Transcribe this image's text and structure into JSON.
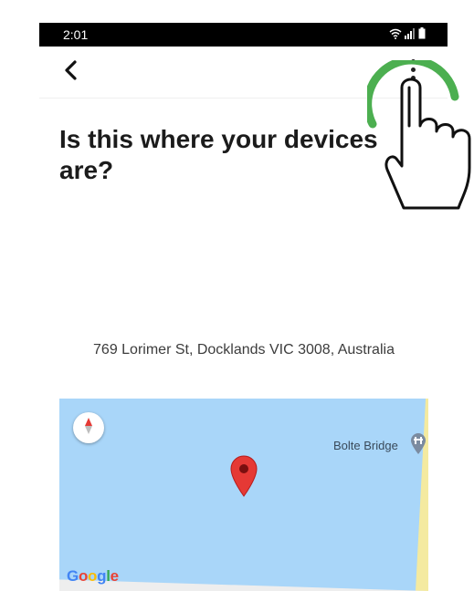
{
  "statusbar": {
    "time": "2:01"
  },
  "icons": {
    "back": "back-arrow-icon",
    "more": "more-vert-icon",
    "compass": "compass-icon",
    "poi": "bridge-icon",
    "pin": "map-pin-icon",
    "wifi": "wifi-icon",
    "signal": "signal-icon",
    "battery": "battery-icon"
  },
  "page": {
    "heading_line1": "Is this where your devices",
    "heading_line2": "are?",
    "address": "769 Lorimer St, Docklands VIC 3008, Australia"
  },
  "map": {
    "poi_label": "Bolte Bridge",
    "attribution": "Google",
    "water_color": "#a9d6f9",
    "pin_color": "#e53935"
  },
  "colors": {
    "status_bar": "#000000",
    "tap_indicator": "#4caf50"
  }
}
